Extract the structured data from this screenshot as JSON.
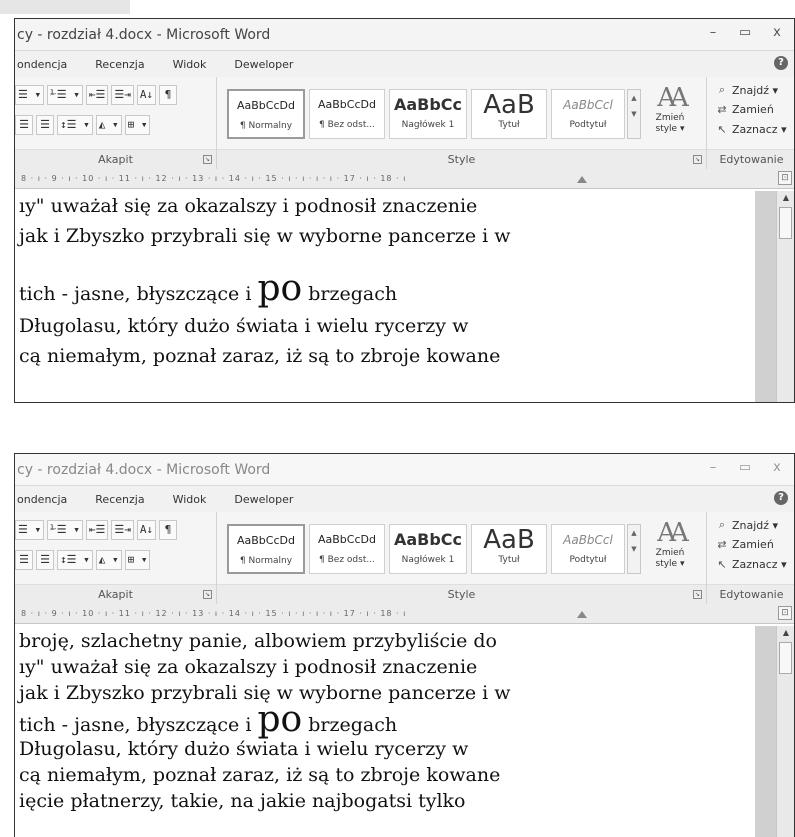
{
  "window": {
    "title": "cy - rozdział 4.docx - Microsoft Word",
    "controls": {
      "minimize": "–",
      "maximize": "▭",
      "close": "x"
    }
  },
  "tabs": [
    "ondencja",
    "Recenzja",
    "Widok",
    "Deweloper"
  ],
  "help_glyph": "?",
  "paragraph": {
    "group_label": "Akapit",
    "row1": [
      "☰ ▾",
      "⅟☰ ▾",
      "⇤☰",
      "☰⇥",
      "A↓",
      "¶"
    ],
    "row2": [
      "☰",
      "☰",
      "↕☰ ▾",
      "◭ ▾",
      "⊞ ▾"
    ]
  },
  "styles": {
    "group_label": "Style",
    "items": [
      {
        "sample": "AaBbCcDd",
        "name": "¶ Normalny",
        "selected": true
      },
      {
        "sample": "AaBbCcDd",
        "name": "¶ Bez odst...",
        "selected": false
      },
      {
        "sample": "AaBbCc",
        "name": "Nagłówek 1",
        "selected": false
      },
      {
        "sample": "AaB",
        "name": "Tytuł",
        "selected": false
      },
      {
        "sample": "AaBbCcl",
        "name": "Podtytuł",
        "selected": false
      }
    ],
    "change_label_1": "Zmień",
    "change_label_2": "style ▾"
  },
  "editing": {
    "group_label": "Edytowanie",
    "find": "Znajdź ▾",
    "replace": "Zamień",
    "select": "Zaznacz ▾"
  },
  "ruler": "8 · ı · 9 · ı · 10 · ı · 11 · ı · 12 · ı · 13 · ı · 14 · ı · 15 · ı · ı · ı · ı · 17 · ı · 18 · ı",
  "doc1": {
    "lines": [
      "ıy\" uważał się za okazalszy i podnosił znaczenie",
      "jak i Zbyszko przybrali się w wyborne pancerze i w",
      "Długolasu, który dużo świata i wielu rycerzy w",
      "cą niemałym, poznał zaraz, iż są to zbroje kowane"
    ],
    "emph_before": "tich - jasne, błyszczące i ",
    "emph_word": "po",
    "emph_after": " brzegach"
  },
  "doc2": {
    "lines": [
      "broję, szlachetny panie, albowiem przybyliście do",
      "ıy\" uważał się za okazalszy i podnosił znaczenie",
      "jak i Zbyszko przybrali się w wyborne pancerze i w",
      "Długolasu, który dużo świata i wielu rycerzy w",
      "cą niemałym, poznał zaraz, iż są to zbroje kowane",
      "ięcie płatnerzy, takie, na jakie najbogatsi tylko"
    ],
    "emph_before": "tich - jasne, błyszczące i ",
    "emph_word": "po",
    "emph_after": " brzegach"
  }
}
